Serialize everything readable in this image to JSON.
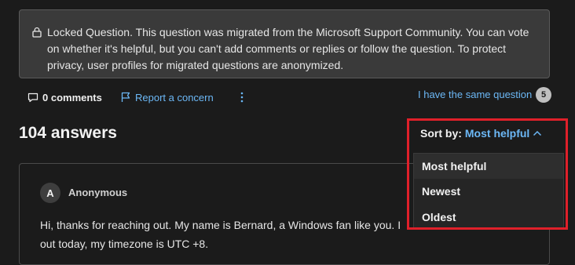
{
  "notice": {
    "icon": "lock-icon",
    "text": "Locked Question. This question was migrated from the Microsoft Support Community. You can vote on whether it's helpful, but you can't add comments or replies or follow the question. To protect privacy, user profiles for migrated questions are anonymized."
  },
  "actions": {
    "comments_label": "0 comments",
    "report_label": "Report a concern",
    "same_question_label": "I have the same question",
    "same_question_count": "5"
  },
  "answers": {
    "count_label": "104 answers",
    "sort_label": "Sort by:",
    "sort_value": "Most helpful",
    "sort_options": [
      "Most helpful",
      "Newest",
      "Oldest"
    ]
  },
  "answer": {
    "avatar_letter": "A",
    "author": "Anonymous",
    "lines": [
      "Hi, thanks for reaching out. My name is Bernard, a Windows fan like you. I",
      "out today, my timezone is UTC +8."
    ]
  },
  "colors": {
    "background": "#1b1b1b",
    "link": "#6cb8f6",
    "highlight": "#e0202a"
  }
}
